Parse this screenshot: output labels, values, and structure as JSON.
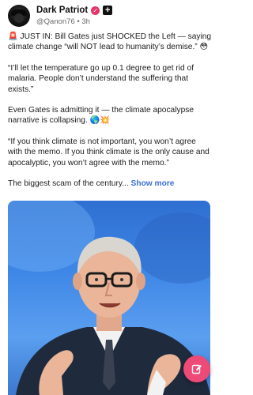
{
  "post": {
    "author": {
      "name": "Dark Patriot",
      "handle": "@Qanon76",
      "separator": "•",
      "time": "3h",
      "verified_glyph": "✓",
      "follow_glyph": "+"
    },
    "paragraphs": [
      "🚨 JUST IN: Bill Gates just SHOCKED the Left — saying climate change “will NOT lead to humanity’s demise.” 😳",
      "“I’ll let the temperature go up 0.1 degree to get rid of malaria. People don’t understand the suffering that exists.”",
      "Even Gates is admitting it — the climate apocalypse narrative is collapsing. 🌎💥",
      "“If you think climate is not important, you won’t agree with the memo. If you think climate is the only cause and apocalyptic, you won’t agree with the memo.”"
    ],
    "teaser": "The biggest scam of the century...",
    "show_more": "Show more"
  },
  "icons": {
    "verified": "verified-badge-icon",
    "follow": "follow-plus-icon",
    "compose": "compose-pencil-icon"
  },
  "colors": {
    "verified": "#e5356b",
    "link": "#3b6fd6",
    "fab": "#ee4a78",
    "photo_background": "#3d86e6"
  }
}
